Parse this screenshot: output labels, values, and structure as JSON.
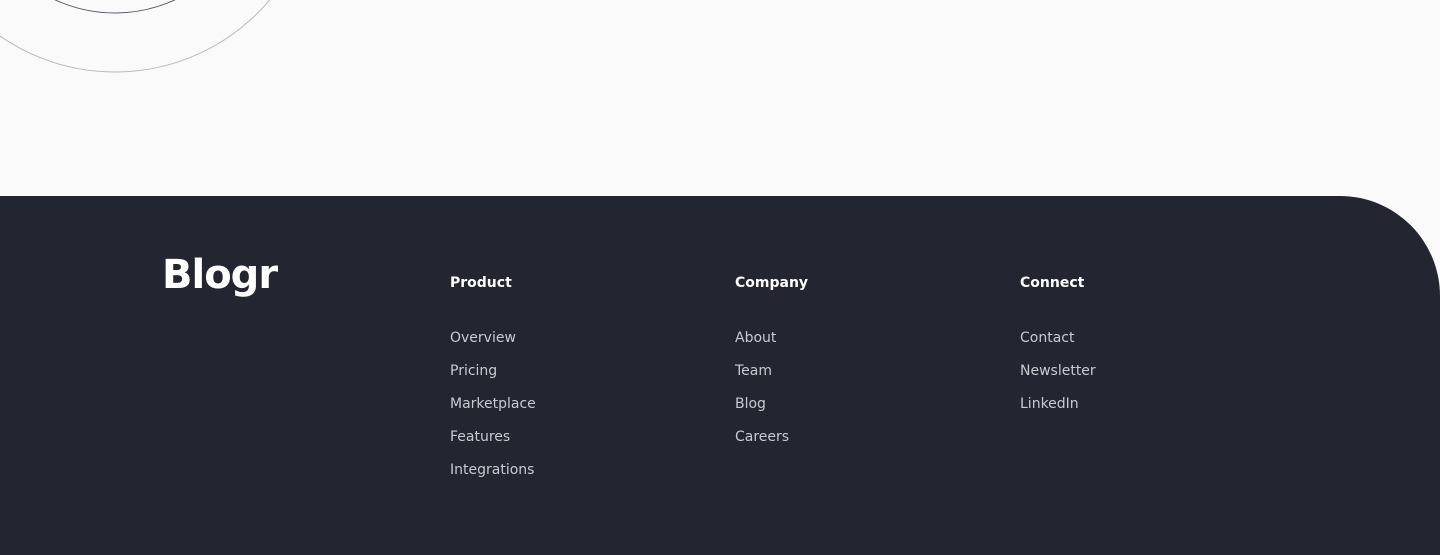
{
  "brand": {
    "name": "Blogr"
  },
  "footer": {
    "columns": [
      {
        "heading": "Product",
        "links": [
          "Overview",
          "Pricing",
          "Marketplace",
          "Features",
          "Integrations"
        ]
      },
      {
        "heading": "Company",
        "links": [
          "About",
          "Team",
          "Blog",
          "Careers"
        ]
      },
      {
        "heading": "Connect",
        "links": [
          "Contact",
          "Newsletter",
          "LinkedIn"
        ]
      }
    ]
  },
  "colors": {
    "page_background": "#fafafa",
    "footer_background": "#232530",
    "heading_text": "#ffffff",
    "link_text": "#c9cad1",
    "decor_stroke": "#8a8d99"
  }
}
